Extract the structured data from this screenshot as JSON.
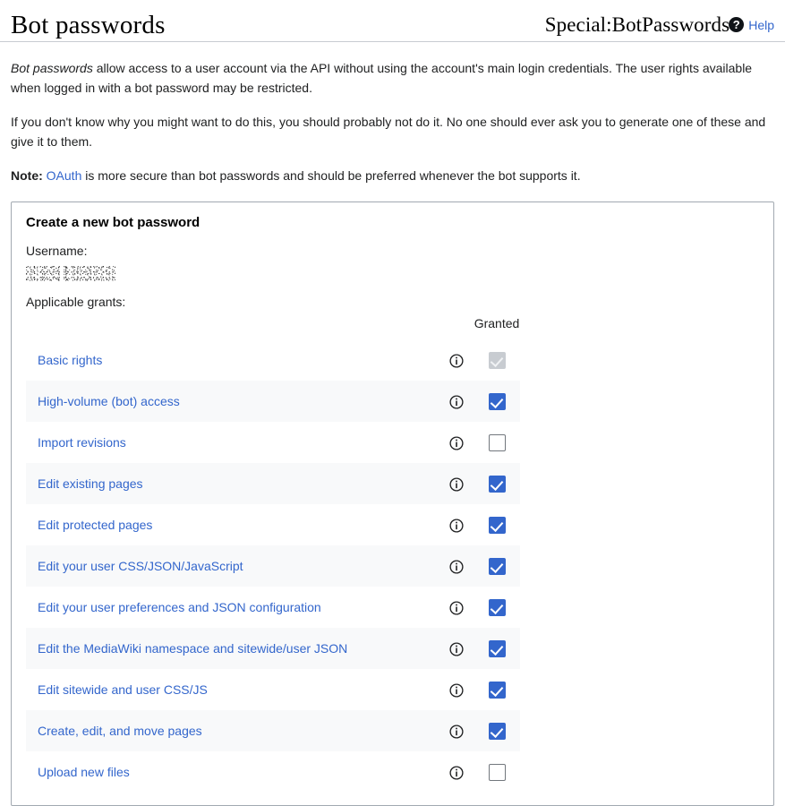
{
  "header": {
    "title": "Bot passwords",
    "subpage_title": "Special:BotPasswords",
    "help_badge": "?",
    "help_label": "Help",
    "help_icon_name": "question-mark-icon"
  },
  "intro": {
    "p1_em": "Bot passwords",
    "p1_rest": " allow access to a user account via the API without using the account's main login credentials. The user rights available when logged in with a bot password may be restricted.",
    "p2": "If you don't know why you might want to do this, you should probably not do it. No one should ever ask you to generate one of these and give it to them.",
    "p3_note": "Note:",
    "p3_link": "OAuth",
    "p3_rest": " is more secure than bot passwords and should be preferred whenever the bot supports it."
  },
  "form": {
    "legend": "Create a new bot password",
    "username_label": "Username:",
    "username_value": "",
    "grants_label": "Applicable grants:"
  },
  "grants_table": {
    "header_granted": "Granted",
    "rows": [
      {
        "label": "Basic rights",
        "state": "disabled"
      },
      {
        "label": "High-volume (bot) access",
        "state": "checked"
      },
      {
        "label": "Import revisions",
        "state": "unchecked"
      },
      {
        "label": "Edit existing pages",
        "state": "checked"
      },
      {
        "label": "Edit protected pages",
        "state": "checked"
      },
      {
        "label": "Edit your user CSS/JSON/JavaScript",
        "state": "checked"
      },
      {
        "label": "Edit your user preferences and JSON configuration",
        "state": "checked"
      },
      {
        "label": "Edit the MediaWiki namespace and sitewide/user JSON",
        "state": "checked"
      },
      {
        "label": "Edit sitewide and user CSS/JS",
        "state": "checked"
      },
      {
        "label": "Create, edit, and move pages",
        "state": "checked"
      },
      {
        "label": "Upload new files",
        "state": "unchecked"
      }
    ]
  },
  "colors": {
    "link": "#3366cc",
    "checkbox_checked": "#3366cc",
    "checkbox_disabled": "#c8ccd1",
    "row_stripe": "#f8f9fa",
    "fieldset_border": "#a2a9b1"
  }
}
